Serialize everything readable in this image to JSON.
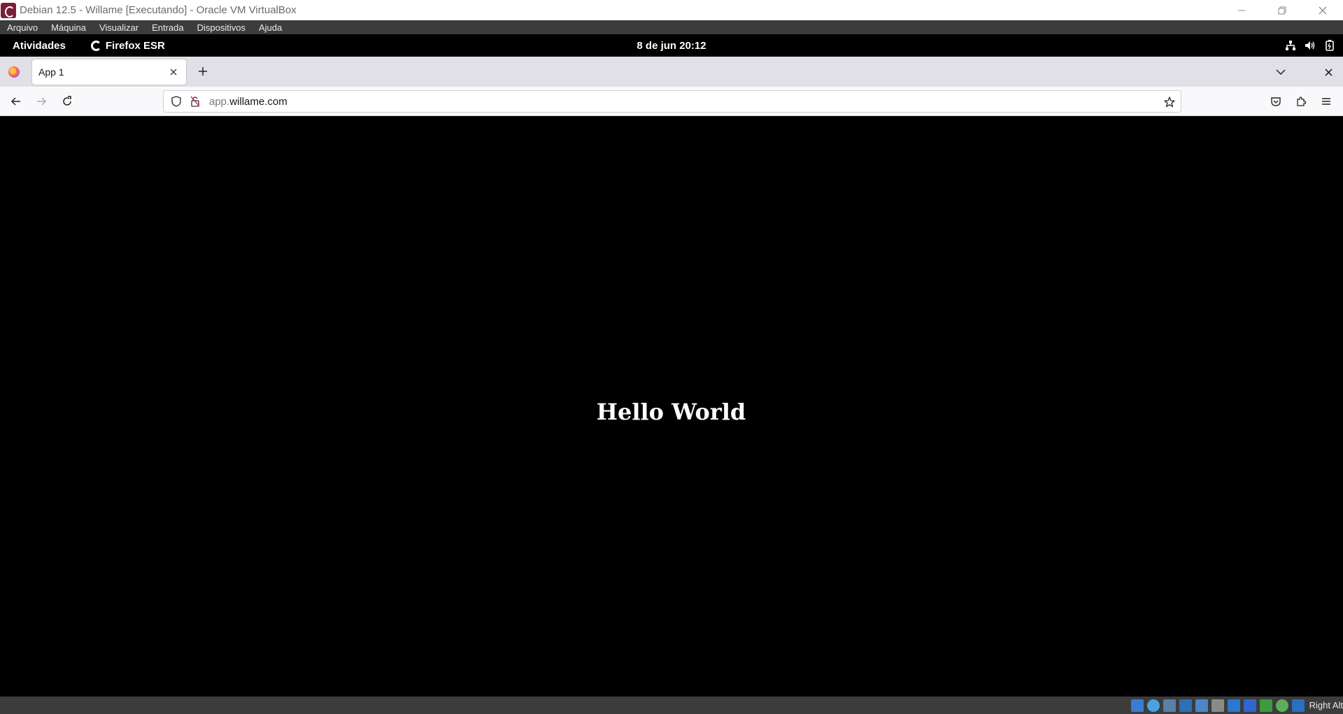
{
  "vbox": {
    "window_title": "Debian 12.5 - Willame [Executando] - Oracle VM VirtualBox",
    "menu": [
      "Arquivo",
      "Máquina",
      "Visualizar",
      "Entrada",
      "Dispositivos",
      "Ajuda"
    ],
    "host_key": "Right Alt",
    "status_icons": [
      "hard-disk-icon",
      "optical-drive-icon",
      "audio-icon",
      "network-icon",
      "usb-icon",
      "shared-folders-icon",
      "display-icon",
      "recording-icon",
      "vrde-icon",
      "cpu-activity-icon",
      "mouse-integration-icon",
      "keyboard-capture-icon"
    ]
  },
  "gnome": {
    "activities": "Atividades",
    "app_name": "Firefox ESR",
    "clock": "8 de jun  20:12"
  },
  "browser": {
    "tab_title": "App 1",
    "url_prefix": "app.",
    "url_domain": "willame.com"
  },
  "page": {
    "heading": "Hello World"
  },
  "colors": {
    "page_background": "#000000",
    "vbox_bar": "#3c3c3c",
    "tabstrip": "#e0e0e6"
  }
}
